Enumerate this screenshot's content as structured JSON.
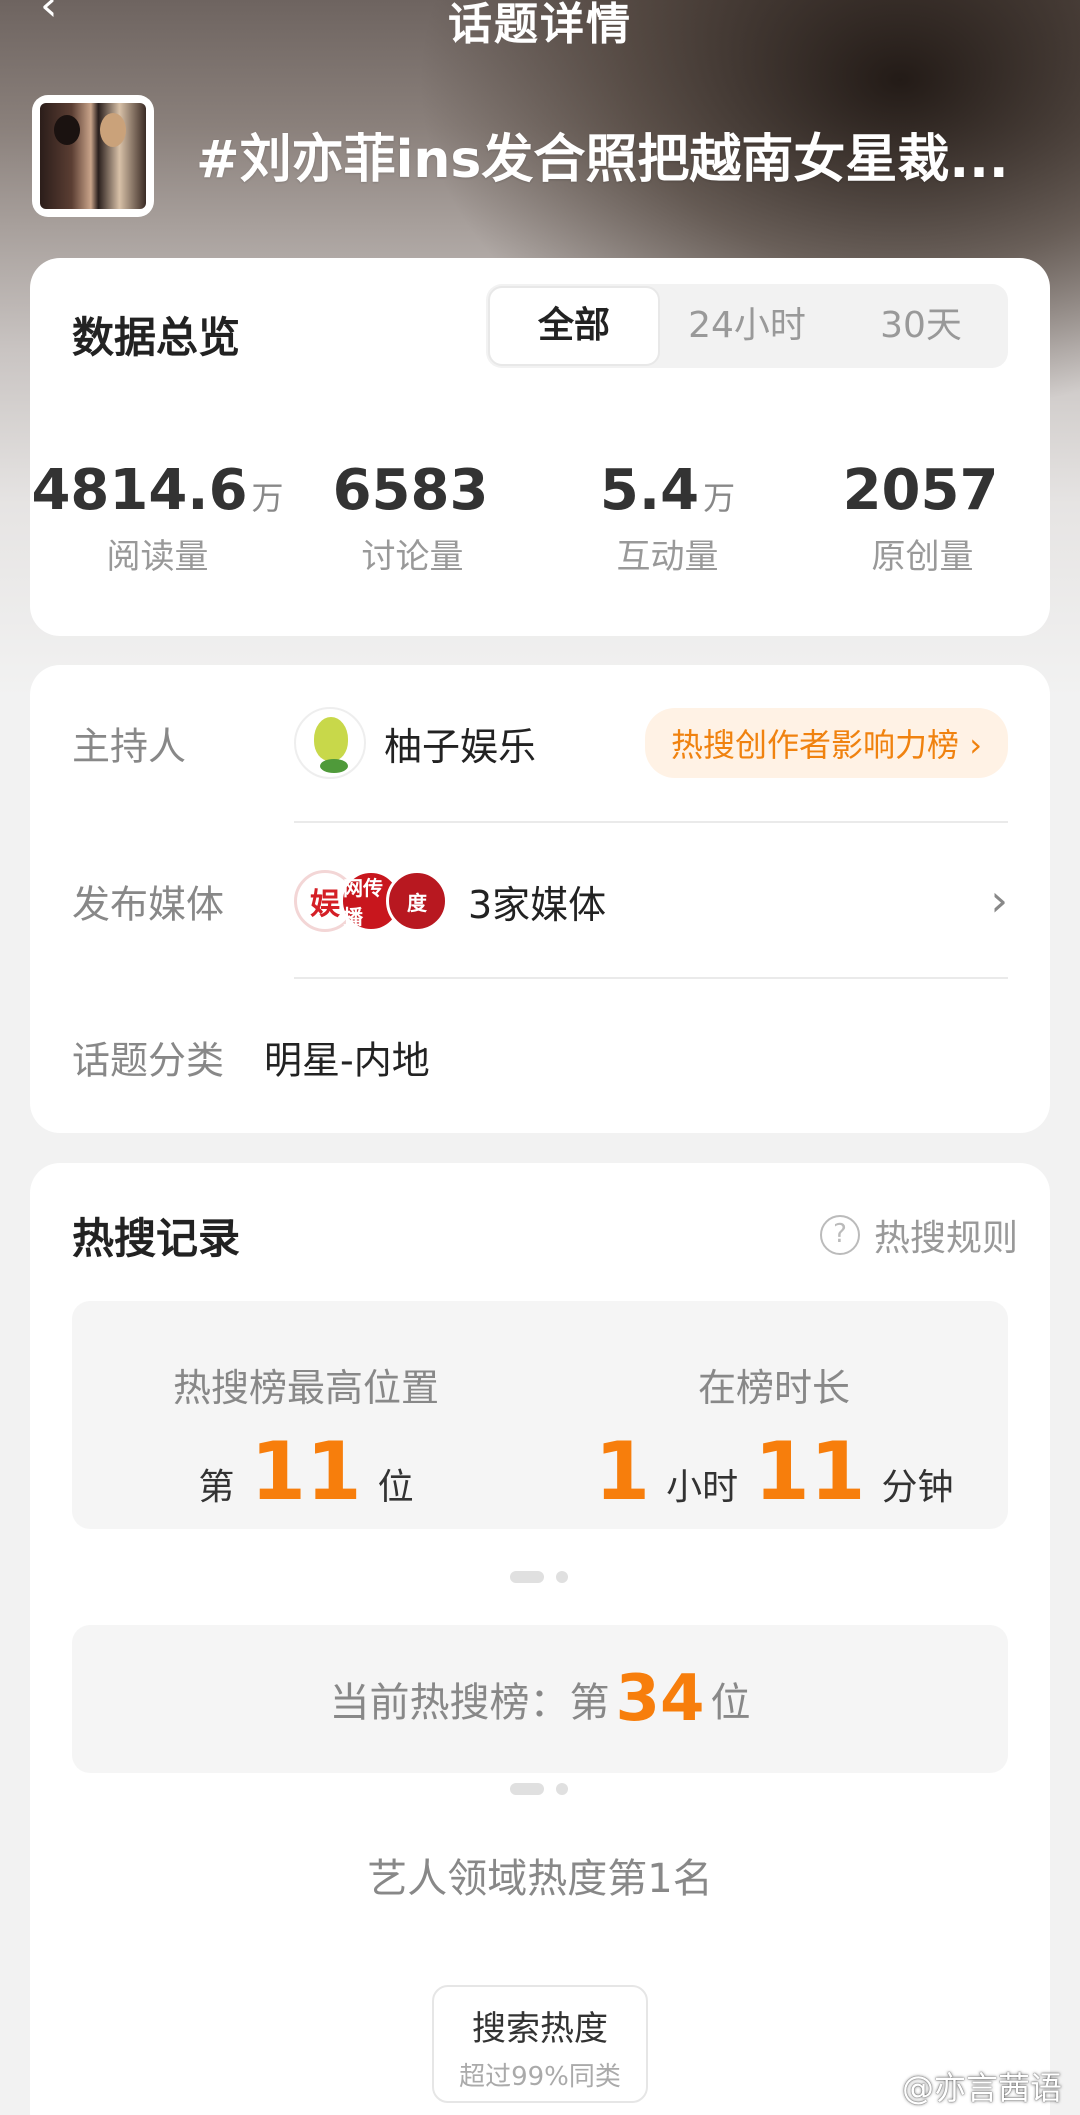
{
  "nav": {
    "title": "话题详情"
  },
  "topic": {
    "title": "#刘亦菲ins发合照把越南女星裁..."
  },
  "overview": {
    "title": "数据总览",
    "tabs": [
      "全部",
      "24小时",
      "30天"
    ],
    "stats": [
      {
        "value": "4814.6",
        "unit": "万",
        "label": "阅读量"
      },
      {
        "value": "6583",
        "unit": "",
        "label": "讨论量"
      },
      {
        "value": "5.4",
        "unit": "万",
        "label": "互动量"
      },
      {
        "value": "2057",
        "unit": "",
        "label": "原创量"
      }
    ]
  },
  "info": {
    "host_label": "主持人",
    "host_name": "柚子娱乐",
    "host_badge": "热搜创作者影响力榜 ›",
    "media_label": "发布媒体",
    "media_logo_text": [
      "娱",
      "网传播",
      "度"
    ],
    "media_count": "3家媒体",
    "category_label": "话题分类",
    "category_value": "明星-内地"
  },
  "hot": {
    "title": "热搜记录",
    "rules": "热搜规则",
    "peak_label": "热搜榜最高位置",
    "peak_prefix": "第",
    "peak_value": "11",
    "peak_suffix": "位",
    "duration_label": "在榜时长",
    "duration_hours": "1",
    "duration_hours_unit": "小时",
    "duration_minutes": "11",
    "duration_minutes_unit": "分钟",
    "current_prefix": "当前热搜榜：第",
    "current_rank": "34",
    "current_suffix": "位",
    "domain_rank": "艺人领域热度第1名",
    "chip_title": "搜索热度",
    "chip_sub": "超过99%同类"
  },
  "watermark": "@亦言茜语",
  "colors": {
    "accent": "#f77e0c",
    "badge_bg": "#fff2e5"
  }
}
